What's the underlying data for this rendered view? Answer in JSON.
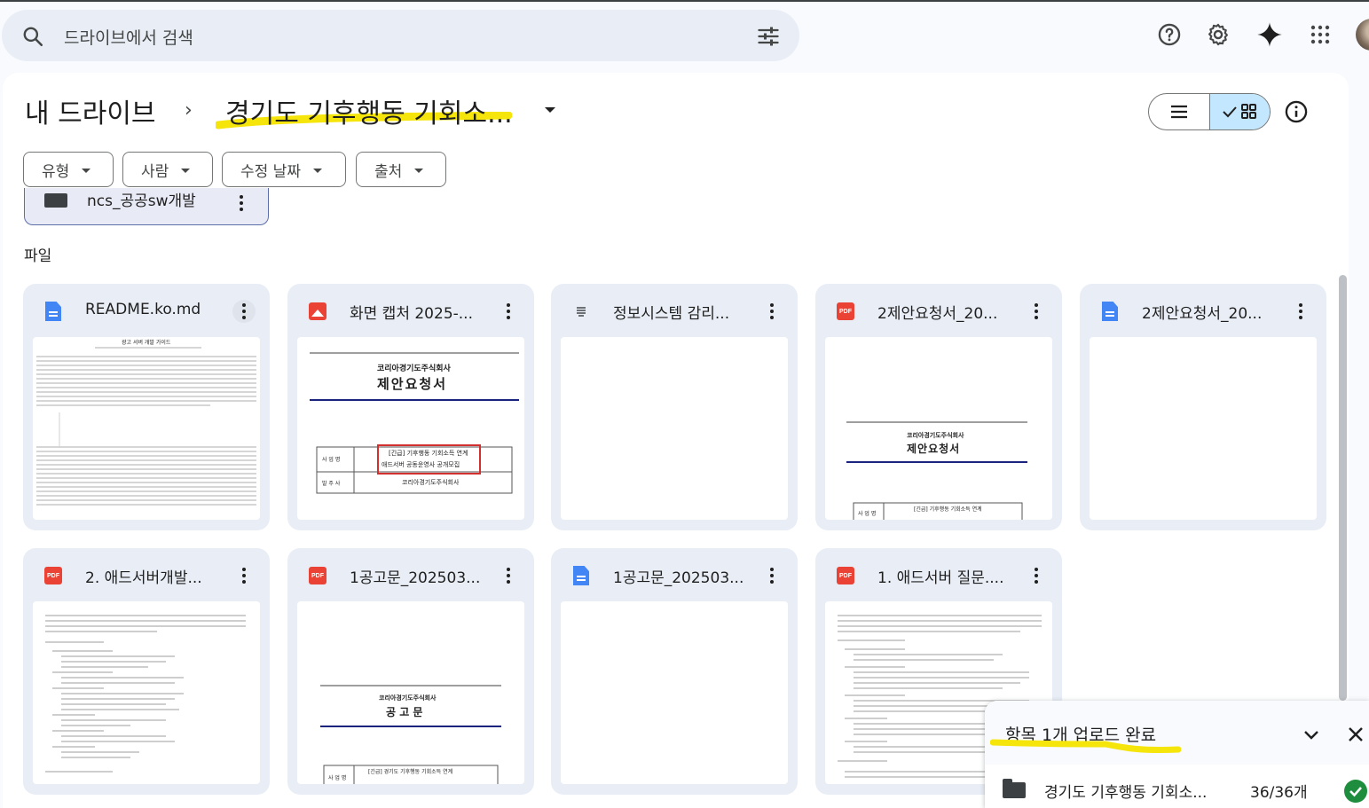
{
  "search": {
    "placeholder": "드라이브에서 검색"
  },
  "breadcrumb": {
    "root": "내 드라이브",
    "separator": "›",
    "current": "경기도 기후행동 기회소..."
  },
  "filters": [
    {
      "label": "유형"
    },
    {
      "label": "사람"
    },
    {
      "label": "수정 날짜"
    },
    {
      "label": "출처"
    }
  ],
  "folder": {
    "name": "ncs_공공sw개발"
  },
  "section": {
    "files_label": "파일"
  },
  "files": [
    {
      "name": "README.ko.md",
      "icon": "doc-icon"
    },
    {
      "name": "화면 캡처 2025-...",
      "icon": "image-icon"
    },
    {
      "name": "정보시스템 감리...",
      "icon": "text-file-icon"
    },
    {
      "name": "2제안요청서_20...",
      "icon": "pdf-icon"
    },
    {
      "name": "2제안요청서_20...",
      "icon": "doc-icon"
    },
    {
      "name": "2. 애드서버개발...",
      "icon": "pdf-icon"
    },
    {
      "name": "1공고문_202503...",
      "icon": "pdf-icon"
    },
    {
      "name": "1공고문_202503...",
      "icon": "doc-icon"
    },
    {
      "name": "1. 애드서버 질문....",
      "icon": "pdf-icon"
    }
  ],
  "thumbs": {
    "readme_title": "광고 서버 개발 가이드",
    "cap_company": "코리아경기도주식회사",
    "cap_doc": "제안요청서",
    "cap_row1_label": "사 업 명",
    "cap_row1_value_1": "[긴급] 기후행동 기회소득 연계",
    "cap_row1_value_2": "애드서버 공동운영사 공개모집",
    "cap_row2_label": "발 주 사",
    "cap_row2_value": "코리아경기도주식회사",
    "rfp_company": "코리아경기도주식회사",
    "rfp_doc": "제안요청서",
    "rfp_row_label": "사 업 명",
    "rfp_row_value": "[긴급] 기후행동 기회소득 연계",
    "notice_company": "코리아경기도주식회사",
    "notice_doc": "공 고 문",
    "notice_row_label": "사 업 명",
    "notice_row_value": "[긴급] 경기도 기후행동 기회소득 연계"
  },
  "upload": {
    "title": "항목 1개 업로드 완료",
    "item_name": "경기도 기후행동 기회소...",
    "item_count": "36/36개"
  },
  "colors": {
    "accent": "#c2e7ff",
    "pdf": "#ea4335",
    "doc": "#4285f4",
    "highlight": "#f5e50a",
    "success": "#1e8e3e"
  }
}
